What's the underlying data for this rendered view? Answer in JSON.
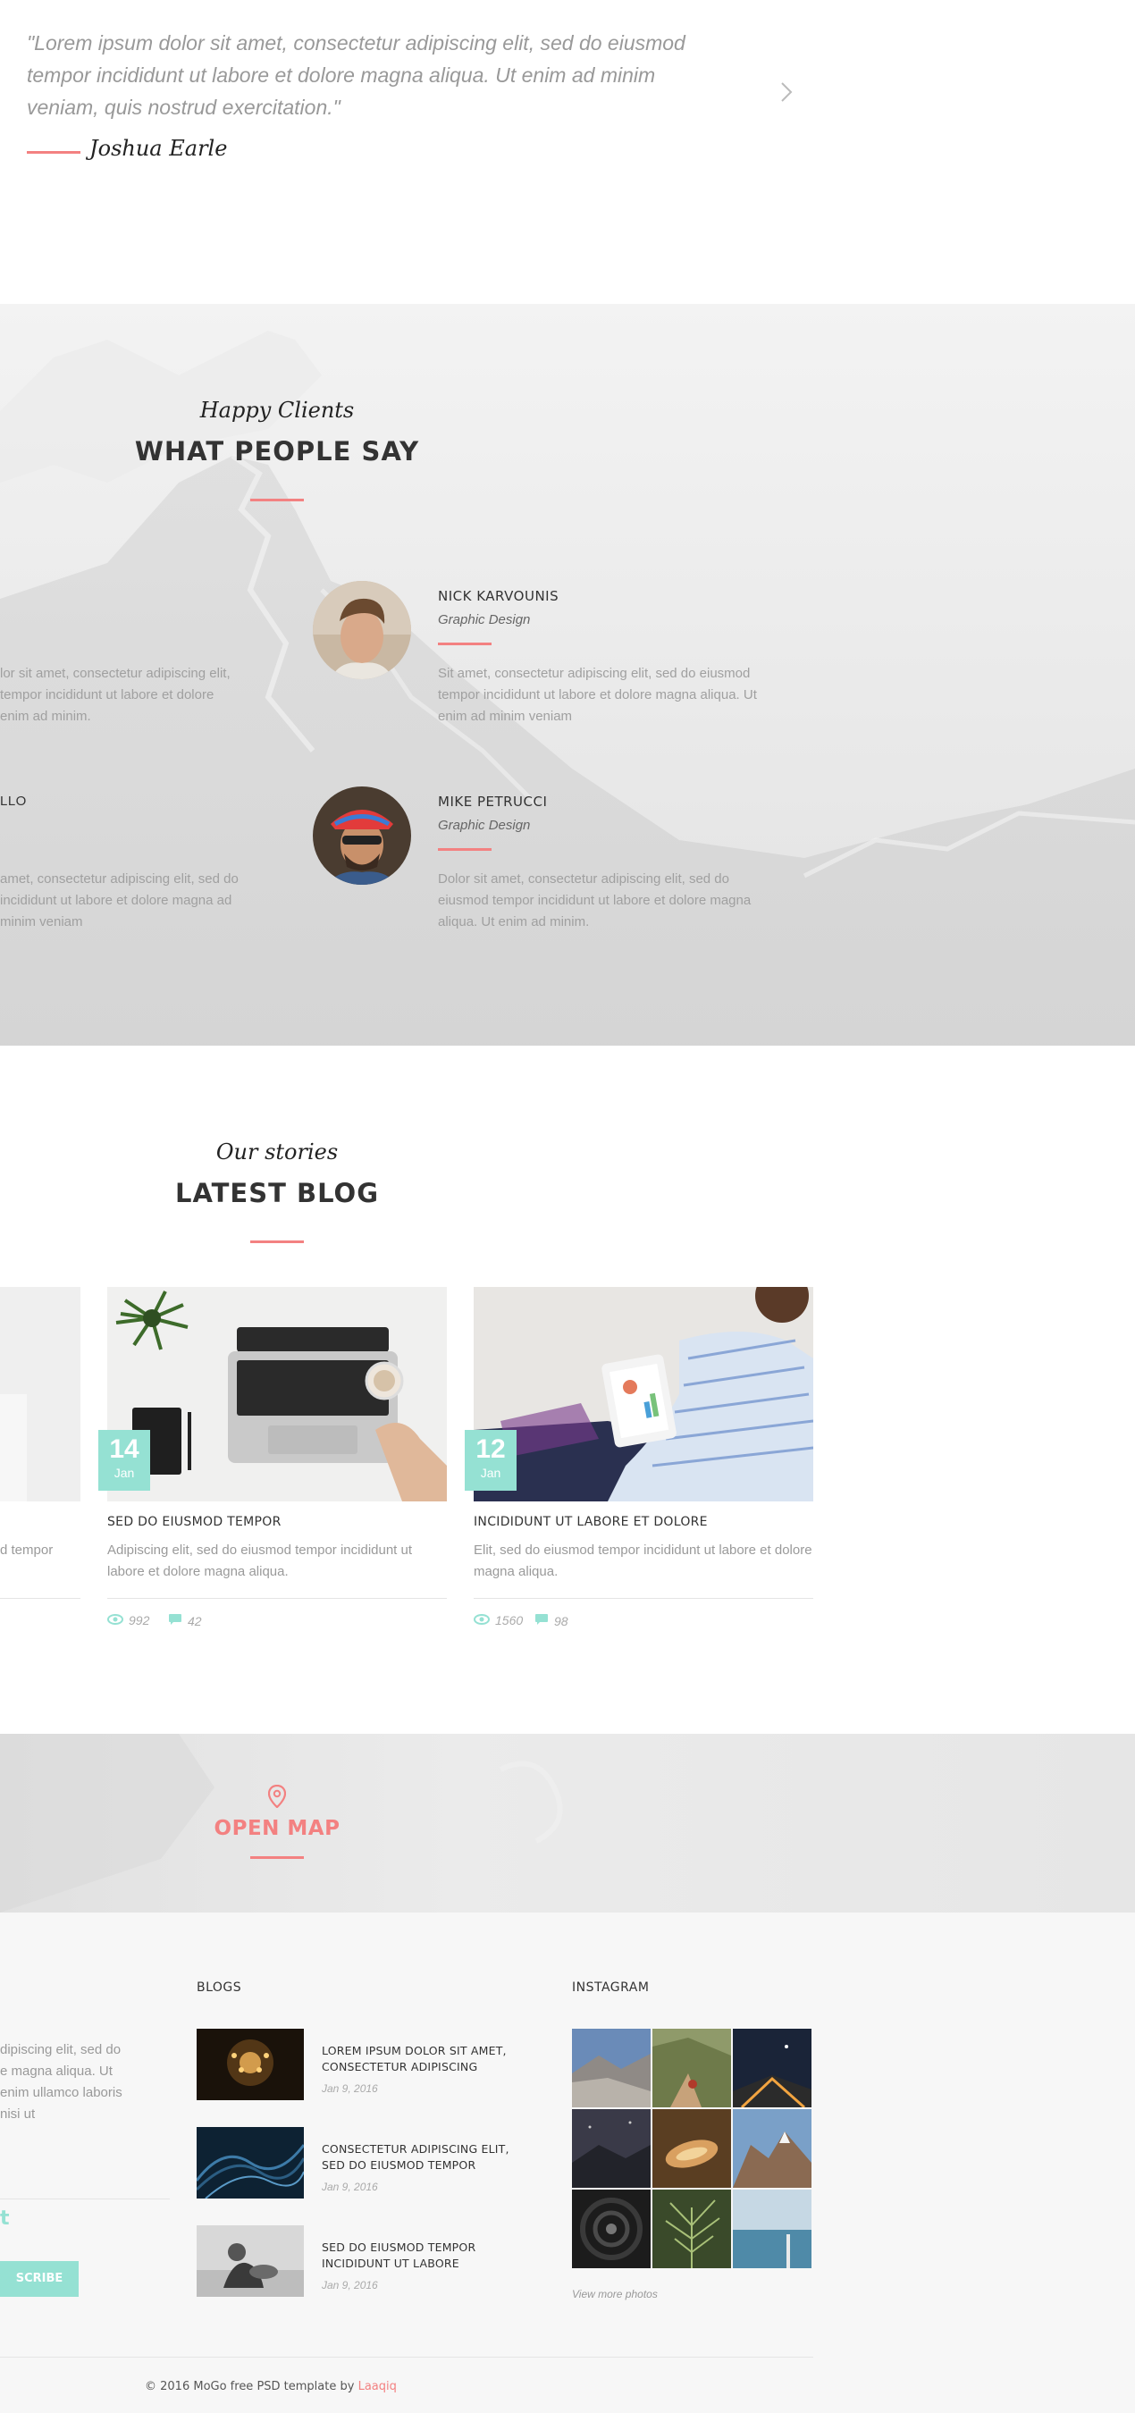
{
  "quote": {
    "text": "\"Lorem ipsum dolor sit amet, consectetur adipiscing elit, sed do eiusmod tempor incididunt ut labore et dolore magna aliqua. Ut enim ad minim veniam, quis nostrud exercitation.\"",
    "author": "Joshua Earle",
    "next_icon": "chevron-right-icon"
  },
  "testimonials": {
    "subtitle": "Happy Clients",
    "title": "WHAT PEOPLE SAY",
    "left_partial": [
      {
        "text": "lor sit amet, consectetur adipiscing elit, tempor incididunt ut labore et dolore enim ad minim."
      },
      {
        "name": "LLO",
        "text": "amet, consectetur adipiscing elit, sed do incididunt ut labore et dolore magna ad minim veniam"
      }
    ],
    "items": [
      {
        "name": "NICK KARVOUNIS",
        "role": "Graphic Design",
        "text": "Sit amet, consectetur adipiscing elit, sed do eiusmod tempor incididunt ut labore et dolore magna aliqua. Ut enim ad minim veniam"
      },
      {
        "name": "MIKE PETRUCCI",
        "role": "Graphic Design",
        "text": "Dolor sit amet, consectetur adipiscing elit, sed do eiusmod tempor incididunt ut labore et dolore magna aliqua. Ut enim ad minim."
      }
    ]
  },
  "blog": {
    "subtitle": "Our stories",
    "title": "LATEST BLOG",
    "partial_card_text": "d tempor",
    "posts": [
      {
        "day": "14",
        "month": "Jan",
        "title": "SED DO EIUSMOD TEMPOR",
        "text": "Adipiscing elit, sed do eiusmod tempor incididunt ut labore et dolore magna aliqua.",
        "views": "992",
        "comments": "42"
      },
      {
        "day": "12",
        "month": "Jan",
        "title": "INCIDIDUNT UT LABORE ET DOLORE",
        "text": "Elit, sed do eiusmod tempor incididunt ut labore et dolore magna aliqua.",
        "views": "1560",
        "comments": "98"
      }
    ]
  },
  "map": {
    "label": "OPEN MAP",
    "icon": "map-pin-icon"
  },
  "footer": {
    "about_partial": "dipiscing elit, sed do e magna aliqua. Ut enim ullamco laboris nisi ut",
    "subscribe_partial_label": "t",
    "subscribe_button": "SCRIBE",
    "blogs_heading": "BLOGS",
    "blog_posts": [
      {
        "title": "LOREM IPSUM DOLOR SIT AMET, CONSECTETUR ADIPISCING",
        "date": "Jan 9, 2016"
      },
      {
        "title": "CONSECTETUR ADIPISCING ELIT, SED DO EIUSMOD TEMPOR",
        "date": "Jan 9, 2016"
      },
      {
        "title": "SED DO EIUSMOD TEMPOR INCIDIDUNT UT LABORE",
        "date": "Jan 9, 2016"
      }
    ],
    "instagram_heading": "INSTAGRAM",
    "view_more": "View more photos",
    "copyright": "© 2016 MoGo free PSD template by",
    "credit": "Laaqiq"
  },
  "colors": {
    "accent": "#f38181",
    "teal": "#95e1d3",
    "text": "#333333",
    "muted": "#999999"
  }
}
